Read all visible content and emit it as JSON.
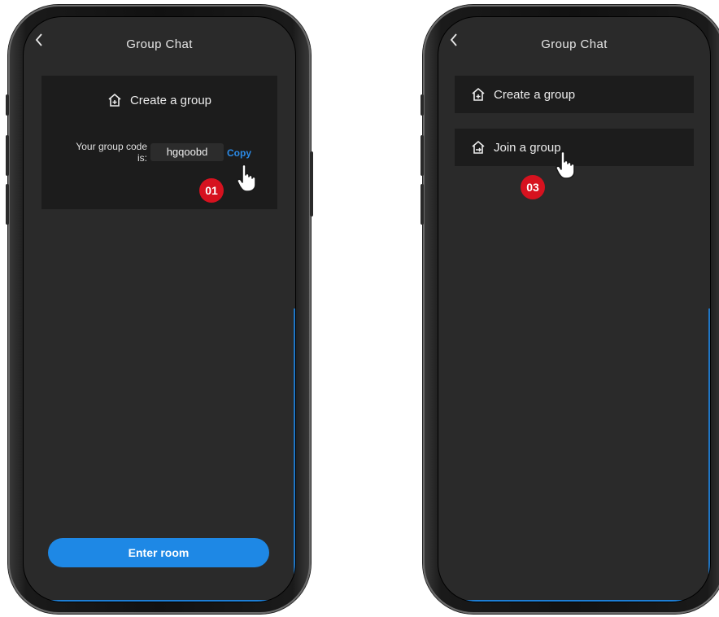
{
  "colors": {
    "accent": "#1e88e5",
    "screen_bg": "#2a2a2a",
    "card_bg": "#1c1c1c",
    "badge": "#d6121f"
  },
  "left_screen": {
    "header": {
      "back_icon": "chevron-left-icon",
      "title": "Group Chat"
    },
    "create_card": {
      "icon": "house-plus-icon",
      "label": "Create a group",
      "code_label_line1": "Your group code",
      "code_label_line2": "is:",
      "code_value": "hgqoobd",
      "copy_label": "Copy"
    },
    "step_badge": "01",
    "enter_button": "Enter room"
  },
  "right_screen": {
    "header": {
      "back_icon": "chevron-left-icon",
      "title": "Group Chat"
    },
    "create_item": {
      "icon": "house-plus-icon",
      "label": "Create a group"
    },
    "join_item": {
      "icon": "house-arrow-icon",
      "label": "Join a group"
    },
    "step_badge": "03"
  }
}
